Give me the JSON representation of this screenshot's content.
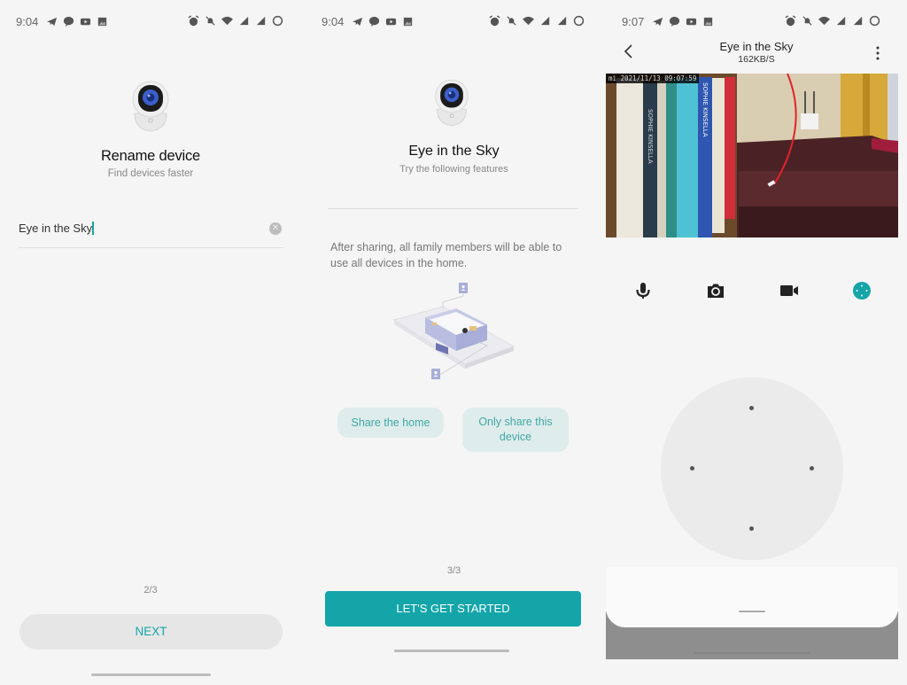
{
  "screens": [
    {
      "status_bar": {
        "time": "9:04",
        "left_icons": [
          "telegram-icon",
          "chat-bubble-icon",
          "youtube-icon",
          "gallery-icon"
        ],
        "right_icons": [
          "alarm-icon",
          "bell-muted-icon",
          "wifi-icon",
          "signal-icon",
          "signal-icon",
          "battery-ring-icon"
        ]
      },
      "title": "Rename device",
      "subtitle": "Find devices faster",
      "name_field": {
        "value": "Eye in the Sky",
        "clear_icon": "clear-circle-icon"
      },
      "page_indicator": "2/3",
      "next_label": "NEXT"
    },
    {
      "status_bar": {
        "time": "9:04",
        "left_icons": [
          "telegram-icon",
          "chat-bubble-icon",
          "youtube-icon",
          "gallery-icon"
        ],
        "right_icons": [
          "alarm-icon",
          "bell-muted-icon",
          "wifi-icon",
          "signal-icon",
          "signal-icon",
          "battery-ring-icon"
        ]
      },
      "title": "Eye in the Sky",
      "subtitle": "Try the following features",
      "description": "After sharing, all family members will be able to use all devices in the home.",
      "share_home_label": "Share the home",
      "share_device_label": "Only share this device",
      "page_indicator": "3/3",
      "start_label": "LET'S GET STARTED"
    },
    {
      "status_bar": {
        "time": "9:07",
        "left_icons": [
          "telegram-icon",
          "chat-bubble-icon",
          "youtube-icon",
          "gallery-icon"
        ],
        "right_icons": [
          "alarm-icon",
          "bell-muted-icon",
          "wifi-icon",
          "signal-icon",
          "signal-icon",
          "battery-ring-icon"
        ]
      },
      "nav": {
        "title": "Eye in the Sky",
        "speed": "162KB/S"
      },
      "video": {
        "timestamp": "mi 2021/11/13  09:07:59"
      },
      "controls": [
        "microphone-icon",
        "camera-icon",
        "video-record-icon",
        "ptz-control-icon"
      ],
      "accent_color": "#14a5a9"
    }
  ]
}
